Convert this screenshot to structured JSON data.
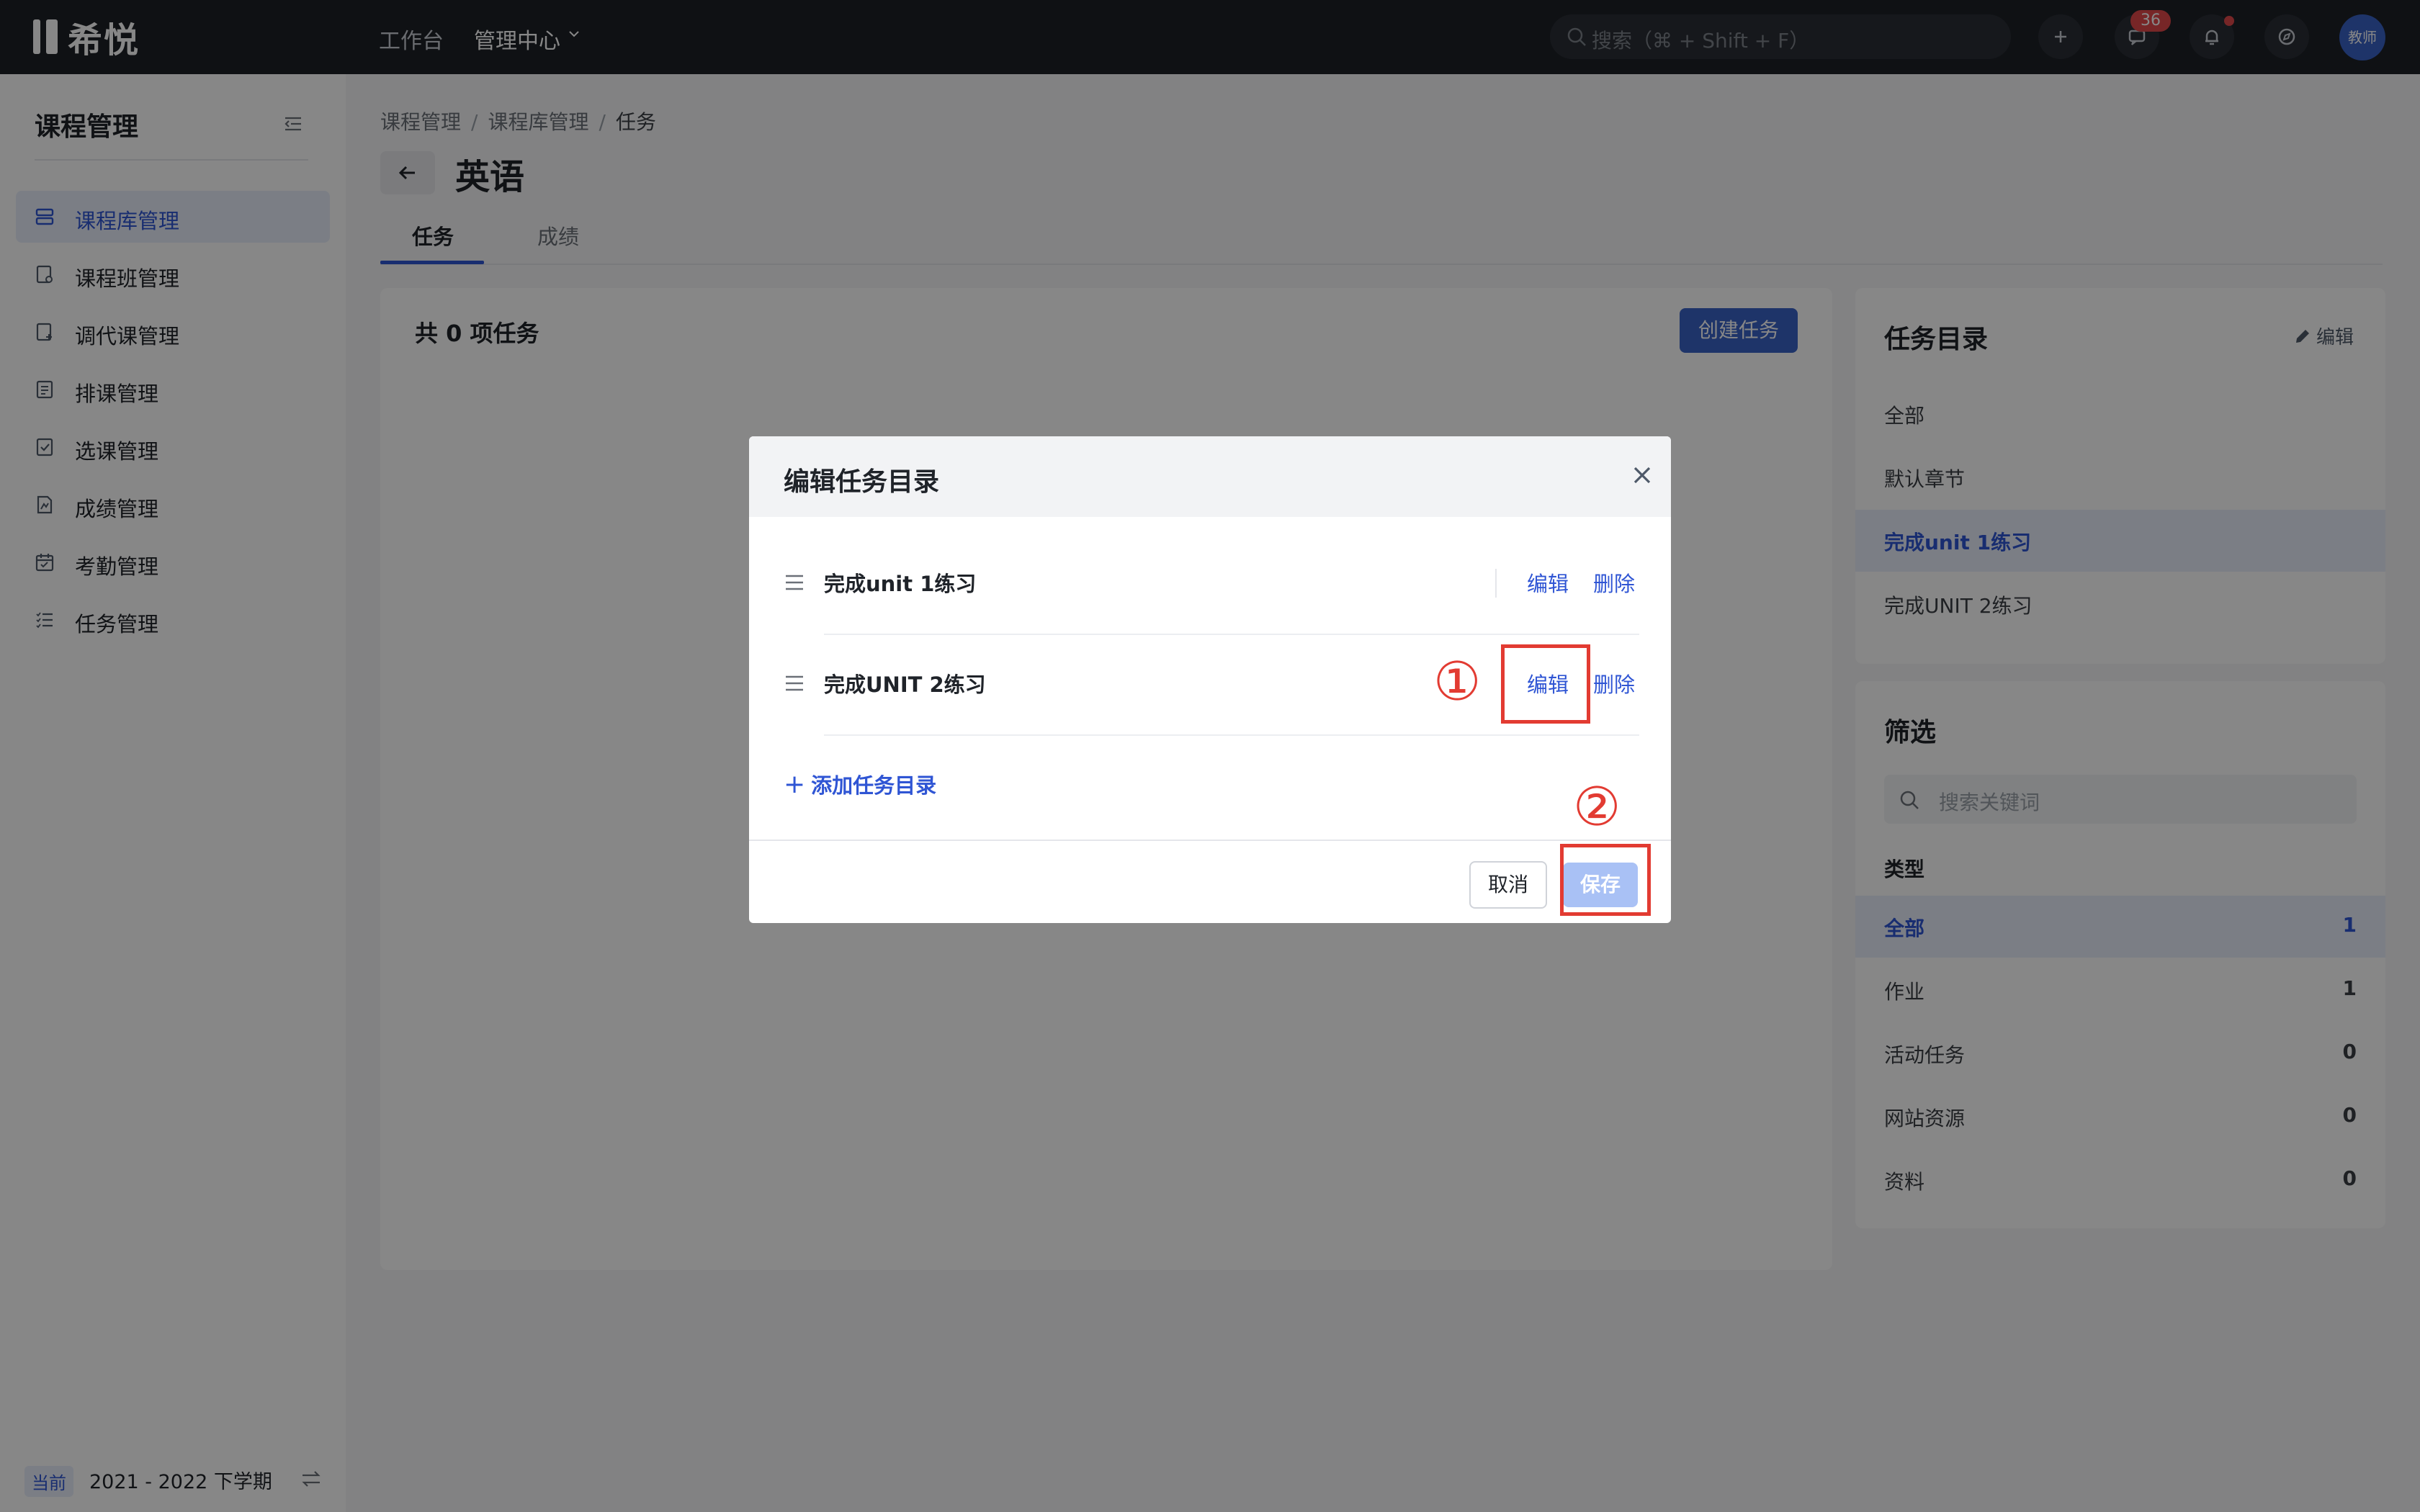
{
  "topbar": {
    "logo_text": "希悦",
    "nav": [
      {
        "label": "工作台"
      },
      {
        "label": "管理中心"
      }
    ],
    "search_placeholder": "搜索（⌘ + Shift + F）",
    "message_badge": "36",
    "avatar_label": "教师"
  },
  "sidebar": {
    "title": "课程管理",
    "items": [
      {
        "label": "课程库管理",
        "icon": "course-library-icon"
      },
      {
        "label": "课程班管理",
        "icon": "course-class-icon"
      },
      {
        "label": "调代课管理",
        "icon": "substitute-icon"
      },
      {
        "label": "排课管理",
        "icon": "schedule-icon"
      },
      {
        "label": "选课管理",
        "icon": "course-select-icon"
      },
      {
        "label": "成绩管理",
        "icon": "grade-icon"
      },
      {
        "label": "考勤管理",
        "icon": "attendance-icon"
      },
      {
        "label": "任务管理",
        "icon": "task-list-icon"
      }
    ],
    "active_index": 0,
    "semester_tag": "当前",
    "semester": "2021 - 2022 下学期"
  },
  "main": {
    "breadcrumb": [
      "课程管理",
      "课程库管理",
      "任务"
    ],
    "title": "英语",
    "tabs": [
      {
        "label": "任务"
      },
      {
        "label": "成绩"
      }
    ],
    "task_count": "共 0 项任务",
    "create_button": "创建任务"
  },
  "catalog": {
    "title": "任务目录",
    "edit_label": "编辑",
    "items": [
      "全部",
      "默认章节",
      "完成unit 1练习",
      "完成UNIT 2练习"
    ],
    "active_index": 2
  },
  "filter": {
    "title": "筛选",
    "search_placeholder": "搜索关键词",
    "type_label": "类型",
    "types": [
      {
        "label": "全部",
        "count": "1"
      },
      {
        "label": "作业",
        "count": "1"
      },
      {
        "label": "活动任务",
        "count": "0"
      },
      {
        "label": "网站资源",
        "count": "0"
      },
      {
        "label": "资料",
        "count": "0"
      }
    ]
  },
  "modal": {
    "title": "编辑任务目录",
    "rows": [
      {
        "name": "完成unit 1练习",
        "edit": "编辑",
        "delete": "删除"
      },
      {
        "name": "完成UNIT 2练习",
        "edit": "编辑",
        "delete": "删除"
      }
    ],
    "add_label": "添加任务目录",
    "cancel": "取消",
    "save": "保存"
  },
  "annotations": {
    "step1": "①",
    "step2": "②",
    "color": "#e23b32"
  },
  "colors": {
    "accent": "#2f55d4",
    "topbar": "#1d2026",
    "badge": "#e0484a"
  }
}
